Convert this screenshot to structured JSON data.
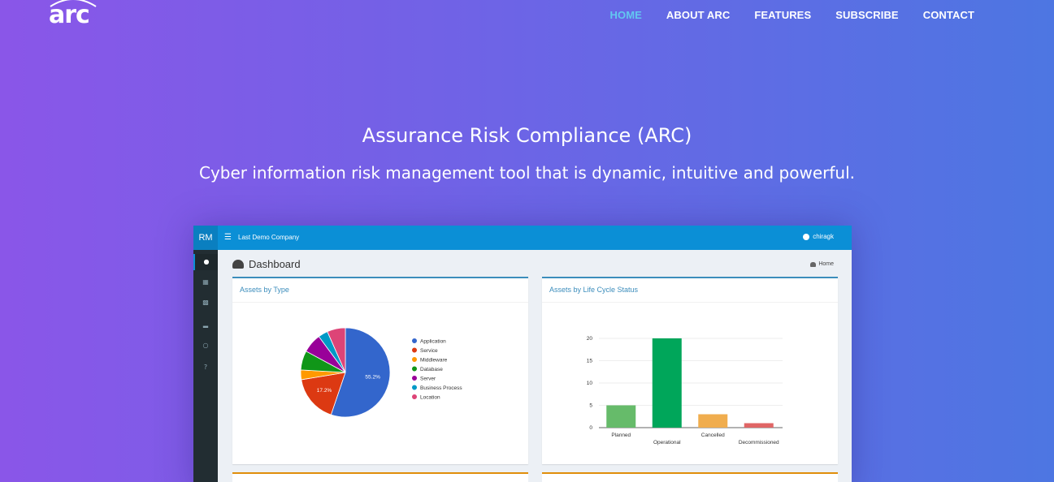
{
  "site": {
    "logo": "arc",
    "nav": [
      {
        "label": "HOME",
        "active": true
      },
      {
        "label": "ABOUT ARC",
        "active": false
      },
      {
        "label": "FEATURES",
        "active": false
      },
      {
        "label": "SUBSCRIBE",
        "active": false
      },
      {
        "label": "CONTACT",
        "active": false
      }
    ],
    "accent_color": "#62c7f0"
  },
  "hero": {
    "title": "Assurance Risk Compliance (ARC)",
    "subtitle": "Cyber information risk management tool that is dynamic, intuitive and powerful."
  },
  "app": {
    "brand": "RM",
    "company": "Last Demo Company",
    "user": "chiragk",
    "dashboard_title": "Dashboard",
    "breadcrumb": "Home",
    "sidebar_icons": [
      "dashboard-icon",
      "building-icon",
      "briefcase-icon",
      "bar-chart-icon",
      "lock-icon",
      "help-icon"
    ],
    "header_color": "#0b8fd6",
    "sidebar_color": "#222d32"
  },
  "chart_data": [
    {
      "type": "pie",
      "title": "Assets by Type",
      "categories": [
        "Application",
        "Service",
        "Middleware",
        "Database",
        "Server",
        "Business Process",
        "Location"
      ],
      "values": [
        55.2,
        17.2,
        3.5,
        7.0,
        7.0,
        3.5,
        6.6
      ],
      "colors": [
        "#3366cc",
        "#dc3912",
        "#ff9900",
        "#109618",
        "#990099",
        "#0099c6",
        "#dd4477"
      ],
      "labels": [
        "55.2%",
        "17.2%"
      ],
      "legend": "right"
    },
    {
      "type": "bar",
      "title": "Assets by Life Cycle Status",
      "categories": [
        "Planned",
        "Operational",
        "Cancelled",
        "Decommissioned"
      ],
      "values": [
        5,
        20,
        3,
        1
      ],
      "colors": [
        "#66bb6a",
        "#00a65a",
        "#f0ad4e",
        "#e06666"
      ],
      "ylim": [
        0,
        20
      ],
      "yticks": [
        0,
        5,
        10,
        15,
        20
      ],
      "grid": true
    }
  ]
}
